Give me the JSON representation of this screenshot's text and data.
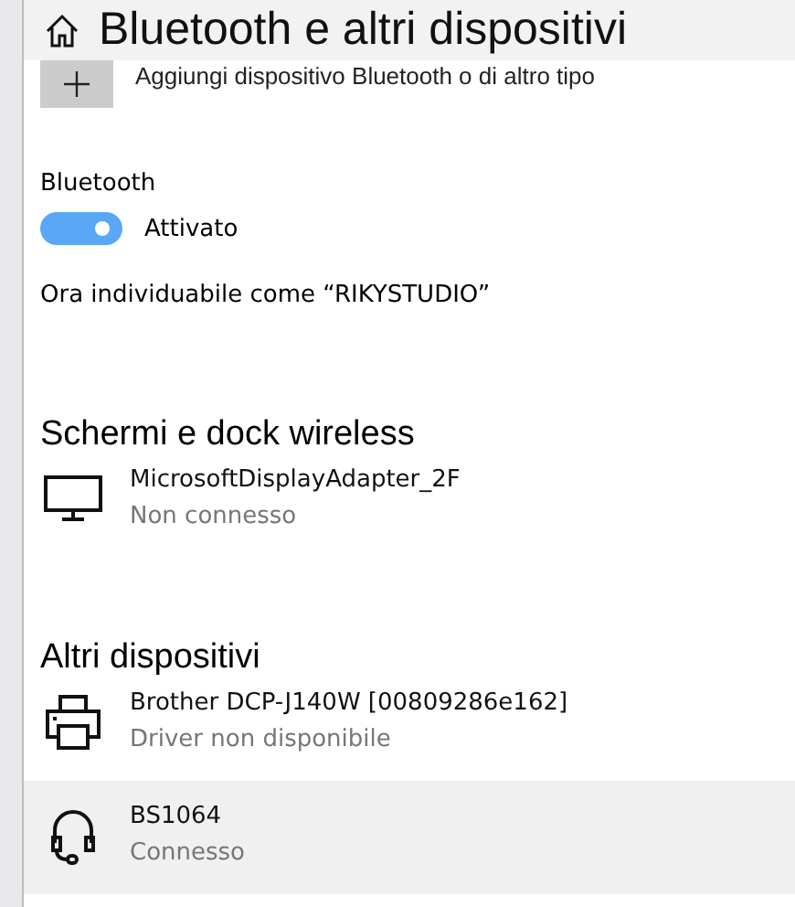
{
  "header": {
    "title": "Bluetooth e altri dispositivi"
  },
  "add_device": {
    "label": "Aggiungi dispositivo Bluetooth o di altro tipo"
  },
  "bluetooth": {
    "label": "Bluetooth",
    "on": true,
    "state_text": "Attivato",
    "discoverable_text": "Ora individuabile come “RIKYSTUDIO”"
  },
  "sections": [
    {
      "title": "Schermi e dock wireless",
      "devices": [
        {
          "kind": "display",
          "name": "MicrosoftDisplayAdapter_2F",
          "status": "Non connesso",
          "selected": false
        }
      ]
    },
    {
      "title": "Altri dispositivi",
      "devices": [
        {
          "kind": "printer",
          "name": "Brother DCP-J140W [00809286e162]",
          "status": "Driver non disponibile",
          "selected": false
        },
        {
          "kind": "headset",
          "name": "BS1064",
          "status": "Connesso",
          "selected": true
        }
      ]
    }
  ]
}
